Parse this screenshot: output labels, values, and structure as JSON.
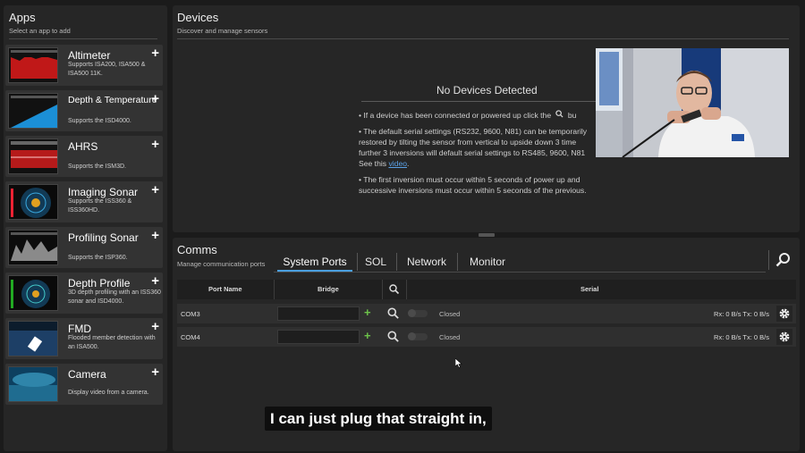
{
  "apps": {
    "title": "Apps",
    "subtitle": "Select an app to add",
    "items": [
      {
        "name": "Altimeter",
        "desc": "Supports ISA200, ISA500 & ISA500 11K.",
        "thumb": "altimeter"
      },
      {
        "name": "Depth & Temperature",
        "desc": "Supports the ISD4000.",
        "thumb": "depth-temp"
      },
      {
        "name": "AHRS",
        "desc": "Supports the ISM3D.",
        "thumb": "ahrs"
      },
      {
        "name": "Imaging Sonar",
        "desc": "Supports the ISS360 & ISS360HD.",
        "thumb": "imaging-sonar"
      },
      {
        "name": "Profiling Sonar",
        "desc": "Supports the ISP360.",
        "thumb": "profiling-sonar"
      },
      {
        "name": "Depth Profile",
        "desc": "3D depth profiling with an ISS360 sonar and ISD4000.",
        "thumb": "depth-profile"
      },
      {
        "name": "FMD",
        "desc": "Flooded member detection with an ISA500.",
        "thumb": "fmd"
      },
      {
        "name": "Camera",
        "desc": "Display video from a camera.",
        "thumb": "camera"
      }
    ]
  },
  "devices": {
    "title": "Devices",
    "subtitle": "Discover and manage sensors",
    "empty_title": "No Devices Detected",
    "bullets": [
      [
        "• If a device has been connected or powered up click the",
        "bu"
      ],
      [
        "• The default serial settings (RS232, 9600, N81) can be temporarily"
      ],
      [
        "restored by tilting the sensor from vertical to upside down 3 time"
      ],
      [
        "further 3 inversions will default serial settings to RS485, 9600, N81"
      ],
      [
        "See this ",
        "video",
        "."
      ],
      [
        "• The first inversion must occur within 5 seconds of power up and"
      ],
      [
        "successive inversions must occur within 5 seconds of the previous."
      ]
    ]
  },
  "comms": {
    "title": "Comms",
    "subtitle": "Manage communication ports",
    "tabs": [
      "System Ports",
      "SOL",
      "Network",
      "Monitor"
    ],
    "active_tab": "System Ports",
    "columns": {
      "port": "Port Name",
      "bridge": "Bridge",
      "serial": "Serial"
    },
    "rows": [
      {
        "port": "COM3",
        "bridge": "",
        "status": "Closed",
        "rate": "Rx: 0 B/s Tx: 0 B/s"
      },
      {
        "port": "COM4",
        "bridge": "",
        "status": "Closed",
        "rate": "Rx: 0 B/s Tx: 0 B/s"
      }
    ]
  },
  "caption": "I can just plug that straight in,",
  "colors": {
    "accent": "#4a9fe0",
    "add": "#6cc24a",
    "panel": "#262626",
    "bg": "#1b1b1b"
  }
}
